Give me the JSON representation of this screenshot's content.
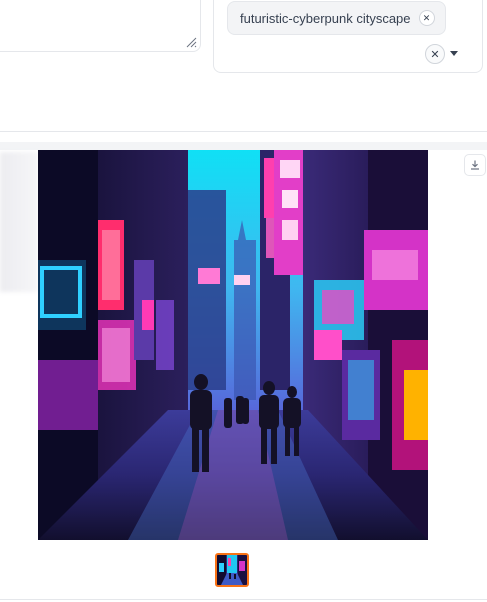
{
  "prompt_box": {
    "value": ""
  },
  "tags": {
    "selected": [
      "futuristic-cyberpunk cityscape"
    ],
    "remove_icon": "close-icon",
    "clear_icon": "close-icon",
    "dropdown_icon": "caret-down-icon"
  },
  "gallery": {
    "image_alt": "",
    "download_icon": "download-icon",
    "thumbnail_count": 1,
    "selected_index": 0,
    "accent": "#f97316"
  }
}
